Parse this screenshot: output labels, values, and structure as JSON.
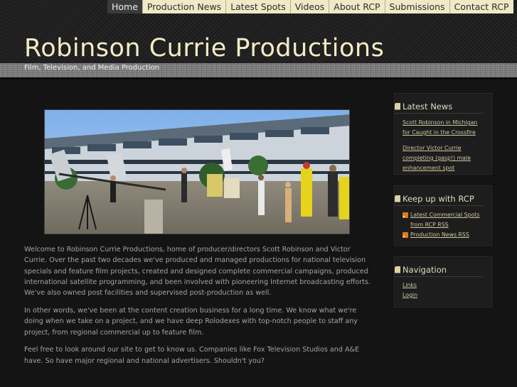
{
  "nav": {
    "items": [
      {
        "label": "Home",
        "active": true
      },
      {
        "label": "Production News",
        "active": false
      },
      {
        "label": "Latest Spots",
        "active": false
      },
      {
        "label": "Videos",
        "active": false
      },
      {
        "label": "About RCP",
        "active": false
      },
      {
        "label": "Submissions",
        "active": false
      },
      {
        "label": "Contact RCP",
        "active": false
      }
    ]
  },
  "header": {
    "title": "Robinson Currie Productions",
    "tagline": "Film, Television, and Media Production"
  },
  "main": {
    "paragraphs": [
      "Welcome to Robinson Currie Productions, home of producer/directors Scott Robinson and Victor Currie. Over the past two decades we've produced and managed productions for national television specials and feature film projects, created and designed complete commercial campaigns, produced international satellite programming, and been involved with pioneering Internet broadcasting efforts. We've also owned post facilities and supervised post-production as well.",
      "In other words, we've been at the content creation business for a long time. We know what we're doing when we take on a project, and we have deep Rolodexes with top-notch people to staff any project, from regional commercial up to feature film.",
      "Feel free to look around our site to get to know us. Companies like Fox Television Studios and A&E have. So have major regional and national advertisers. Shouldn't you?"
    ]
  },
  "sidebar": {
    "latest_news": {
      "title": "Latest News",
      "items": [
        "Scott Robinson in Michigan for Caught in the Crossfire",
        "Director Victor Currie completing (gasp!) male enhancement spot"
      ]
    },
    "keep_up": {
      "title": "Keep up with RCP",
      "items": [
        "Latest Commercial Spots from RCP RSS",
        "Production News RSS"
      ]
    },
    "navigation": {
      "title": "Navigation",
      "items": [
        "Links",
        "Login"
      ]
    }
  },
  "colors": {
    "accent": "#efe9c6",
    "title": "#f2ecc6",
    "background": "#141414",
    "rss": "#e07b1d"
  }
}
